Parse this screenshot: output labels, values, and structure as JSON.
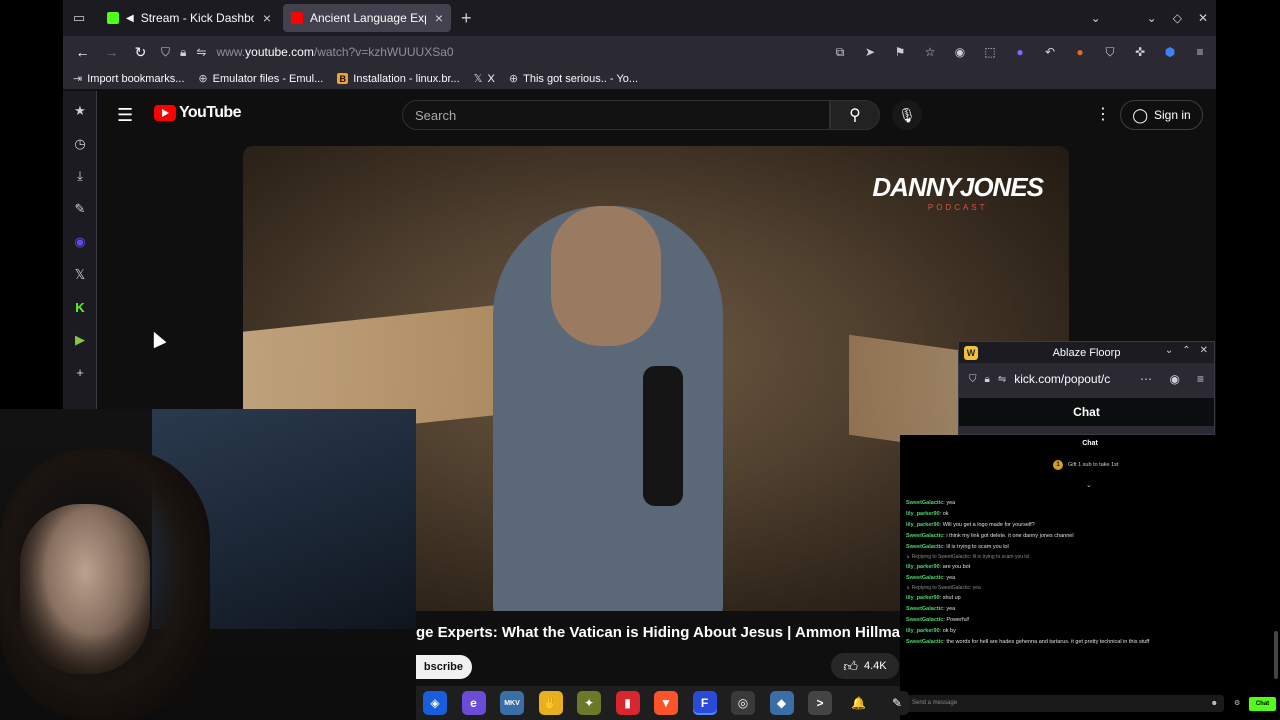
{
  "tabs": [
    {
      "label": "Stream - Kick Dashboa",
      "favicon_color": "#53fc18",
      "active": false
    },
    {
      "label": "Ancient Language Experts",
      "favicon_color": "#ff0000",
      "active": true
    }
  ],
  "nav": {
    "url_prefix": "www.",
    "url_domain": "youtube.com",
    "url_path": "/watch?v=kzhWUUUXSa0"
  },
  "bookmarks": [
    {
      "icon": "import-icon",
      "label": "Import bookmarks..."
    },
    {
      "icon": "globe-icon",
      "label": "Emulator files - Emul..."
    },
    {
      "icon": "b-icon",
      "label": "Installation - linux.br..."
    },
    {
      "icon": "x-icon",
      "label": "X"
    },
    {
      "icon": "globe-icon",
      "label": "This got serious.. - Yo..."
    }
  ],
  "youtube": {
    "search_placeholder": "Search",
    "signin_label": "Sign in",
    "logo_text": "YouTube",
    "video_title": "ge Experts: What the Vatican is Hiding About Jesus | Ammon Hillman",
    "subscribe_label": "bscribe",
    "like_count": "4.4K",
    "brand_line1": "DANNYJONES",
    "brand_line2": "PODCAST"
  },
  "floorp": {
    "title": "Ablaze Floorp",
    "url": "kick.com/popout/c",
    "header": "Chat"
  },
  "kick_chat": {
    "title": "Chat",
    "pinned": "Gift 1 sub to take 1st",
    "messages": [
      {
        "user": "SweetGalactic",
        "text": "yea",
        "color": "#4fd66a"
      },
      {
        "user": "lily_parker90",
        "text": "ok",
        "color": "#4fd66a"
      },
      {
        "user": "lily_parker90",
        "text": "Will you get a logo made for yourself?",
        "color": "#4fd66a"
      },
      {
        "user": "SweetGalactic",
        "text": "i think my link got delete. it one danny jones channel",
        "color": "#4fd66a"
      },
      {
        "user": "SweetGalactic",
        "text": "lil is trying to scam you lol",
        "color": "#4fd66a"
      },
      {
        "reply": "Replying to SweetGalactic: lil is trying to scam you lol"
      },
      {
        "user": "lily_parker90",
        "text": "are you bot",
        "color": "#4fd66a"
      },
      {
        "user": "SweetGalactic",
        "text": "yea",
        "color": "#4fd66a"
      },
      {
        "reply": "Replying to SweetGalactic: yea"
      },
      {
        "user": "lily_parker90",
        "text": "shut up",
        "color": "#4fd66a"
      },
      {
        "user": "SweetGalactic",
        "text": "yea",
        "color": "#4fd66a"
      },
      {
        "user": "SweetGalactic",
        "text": "Powerful!",
        "color": "#4fd66a"
      },
      {
        "user": "lily_parker90",
        "text": "ok by",
        "color": "#4fd66a"
      },
      {
        "user": "SweetGalactic",
        "text": "the words for hell are hades gehenna and tartarus. it get pretty technical in this stuff",
        "color": "#4fd66a"
      }
    ],
    "input_placeholder": "Send a message",
    "send_label": "Chat"
  },
  "taskbar": [
    {
      "icon": "bitwarden-icon",
      "glyph": "◈",
      "color": "#175ddc"
    },
    {
      "icon": "edge-icon",
      "glyph": "e",
      "color": "#6a4cd6"
    },
    {
      "icon": "mkv-icon",
      "glyph": "MKV",
      "color": "#3a6ea5"
    },
    {
      "icon": "wave-hand-icon",
      "glyph": "✋",
      "color": "#e8b020"
    },
    {
      "icon": "tool-icon",
      "glyph": "✦",
      "color": "#6b7a2a"
    },
    {
      "icon": "files-icon",
      "glyph": "▮",
      "color": "#d8262f"
    },
    {
      "icon": "brave-icon",
      "glyph": "▼",
      "color": "#fb542b"
    },
    {
      "icon": "floorp-icon",
      "glyph": "F",
      "color": "#2a4bd8"
    },
    {
      "icon": "obs-icon",
      "glyph": "◎",
      "color": "#3a3a3a"
    },
    {
      "icon": "vscode-icon",
      "glyph": "◆",
      "color": "#3a6ea5"
    },
    {
      "icon": "terminal-icon",
      "glyph": ">",
      "color": "#444"
    },
    {
      "icon": "bell-icon",
      "glyph": "🔔",
      "color": "#1e1e1e"
    },
    {
      "icon": "pen-icon",
      "glyph": "✎",
      "color": "#1e1e1e"
    }
  ]
}
